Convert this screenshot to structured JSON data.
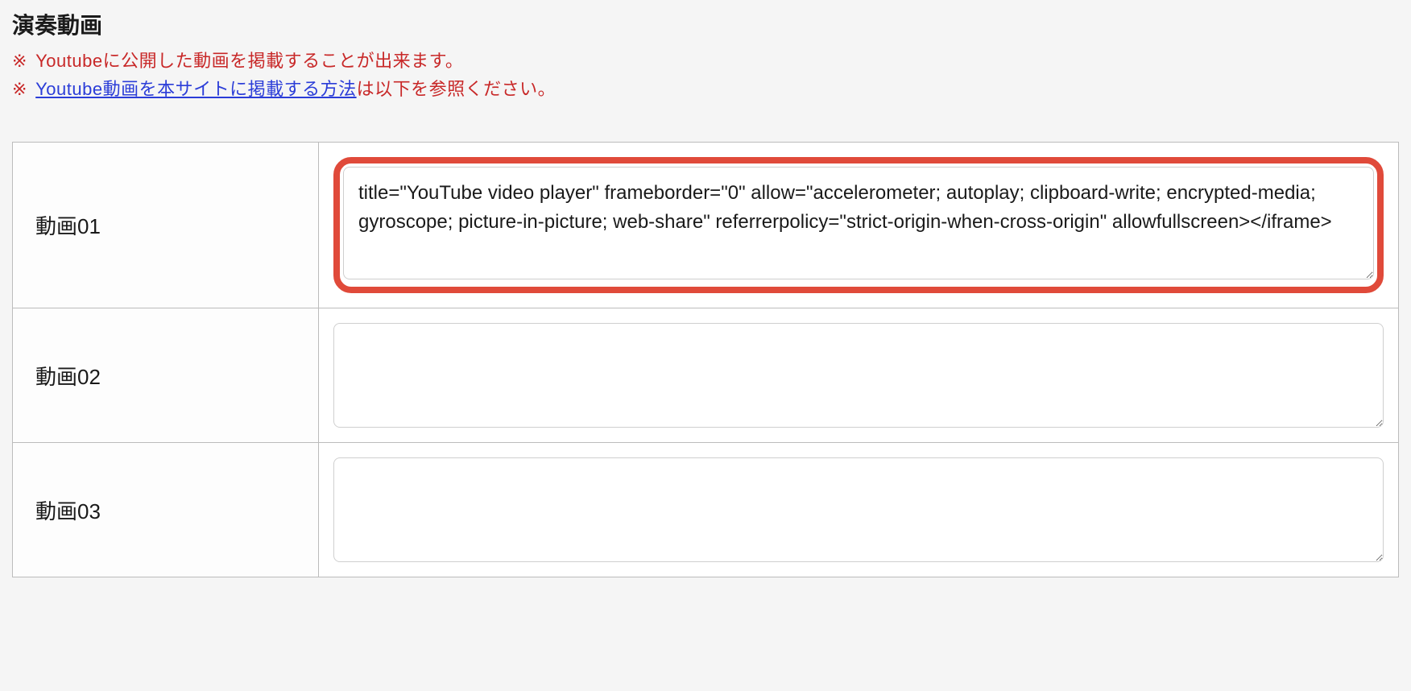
{
  "section": {
    "title": "演奏動画"
  },
  "notices": {
    "line1_prefix": "※",
    "line1_text": "Youtubeに公開した動画を掲載することが出来ます。",
    "line2_prefix": "※",
    "line2_link": "Youtube動画を本サイトに掲載する方法",
    "line2_suffix": "は以下を参照ください。"
  },
  "rows": [
    {
      "label": "動画01",
      "value": "title=\"YouTube video player\" frameborder=\"0\" allow=\"accelerometer; autoplay; clipboard-write; encrypted-media; gyroscope; picture-in-picture; web-share\" referrerpolicy=\"strict-origin-when-cross-origin\" allowfullscreen></iframe>",
      "highlighted": true
    },
    {
      "label": "動画02",
      "value": "",
      "highlighted": false
    },
    {
      "label": "動画03",
      "value": "",
      "highlighted": false
    }
  ]
}
